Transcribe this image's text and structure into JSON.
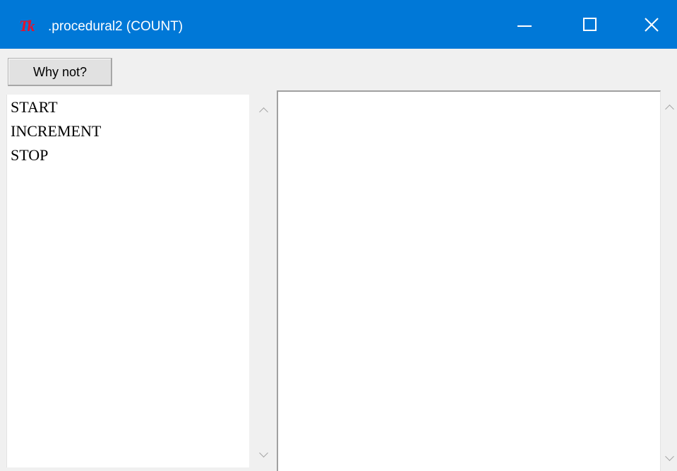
{
  "window": {
    "title": ".procedural2 (COUNT)",
    "app_icon_text": "Tk",
    "app_icon": "tk-logo-icon",
    "controls": {
      "minimize": "minimize-icon",
      "maximize": "maximize-icon",
      "close": "close-icon"
    },
    "titlebar_color": "#0078d7",
    "icon_color": "#e8102a"
  },
  "toolbar": {
    "why_not_label": "Why not?"
  },
  "listbox": {
    "items": [
      {
        "label": "START"
      },
      {
        "label": "INCREMENT"
      },
      {
        "label": "STOP"
      }
    ]
  },
  "text_panel": {
    "content": ""
  }
}
